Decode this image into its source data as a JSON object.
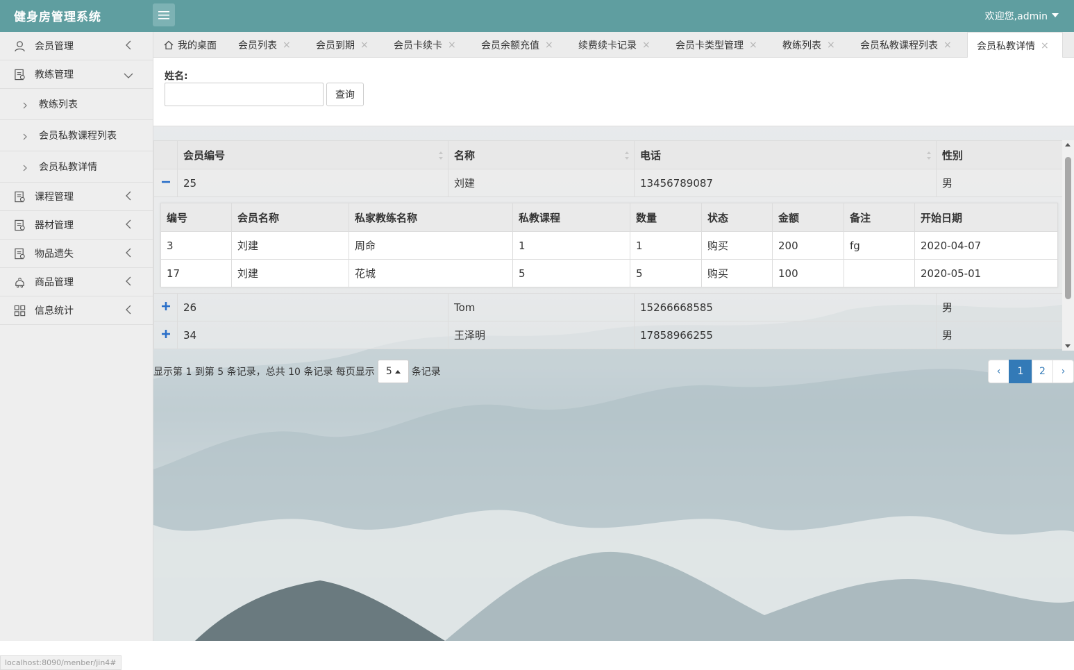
{
  "app": {
    "title": "健身房管理系统",
    "user_greeting": "欢迎您,admin"
  },
  "sidebar": {
    "items": [
      {
        "label": "会员管理",
        "icon": "user-icon"
      },
      {
        "label": "教练管理",
        "icon": "document-icon",
        "expanded": true,
        "children": [
          {
            "label": "教练列表"
          },
          {
            "label": "会员私教课程列表"
          },
          {
            "label": "会员私教详情"
          }
        ]
      },
      {
        "label": "课程管理",
        "icon": "document-icon"
      },
      {
        "label": "器材管理",
        "icon": "document-icon"
      },
      {
        "label": "物品遗失",
        "icon": "document-icon"
      },
      {
        "label": "商品管理",
        "icon": "cart-icon"
      },
      {
        "label": "信息统计",
        "icon": "grid-icon"
      }
    ]
  },
  "tabs": [
    {
      "label": "我的桌面",
      "closable": false
    },
    {
      "label": "会员列表",
      "closable": true
    },
    {
      "label": "会员到期",
      "closable": true
    },
    {
      "label": "会员卡续卡",
      "closable": true
    },
    {
      "label": "会员余额充值",
      "closable": true
    },
    {
      "label": "续费续卡记录",
      "closable": true
    },
    {
      "label": "会员卡类型管理",
      "closable": true
    },
    {
      "label": "教练列表",
      "closable": true
    },
    {
      "label": "会员私教课程列表",
      "closable": true
    },
    {
      "label": "会员私教详情",
      "closable": true,
      "active": true
    }
  ],
  "tab_close_glyph": "×",
  "search": {
    "label": "姓名:",
    "value": "",
    "placeholder": "",
    "button_label": "查询"
  },
  "table": {
    "columns": [
      "会员编号",
      "名称",
      "电话",
      "性别"
    ],
    "rows": [
      {
        "expander": "−",
        "cells": [
          "25",
          "刘建",
          "13456789087",
          "男"
        ]
      },
      {
        "expander": "+",
        "cells": [
          "26",
          "Tom",
          "15266668585",
          "男"
        ]
      },
      {
        "expander": "+",
        "cells": [
          "34",
          "王泽明",
          "17858966255",
          "男"
        ]
      }
    ],
    "detail": {
      "columns": [
        "编号",
        "会员名称",
        "私家教练名称",
        "私教课程",
        "数量",
        "状态",
        "金额",
        "备注",
        "开始日期"
      ],
      "rows": [
        [
          "3",
          "刘建",
          "周命",
          "1",
          "1",
          "购买",
          "200",
          "fg",
          "2020-04-07"
        ],
        [
          "17",
          "刘建",
          "花城",
          "5",
          "5",
          "购买",
          "100",
          "",
          "2020-05-01"
        ]
      ]
    }
  },
  "pagination": {
    "info_prefix": "显示第 1 到第 5 条记录，总共 10 条记录 每页显示",
    "page_size": "5",
    "info_suffix": "条记录",
    "prev": "‹",
    "pages": [
      "1",
      "2"
    ],
    "current_page": "1",
    "next": "›"
  },
  "status_bar": "localhost:8090/menber/jin4#",
  "colors": {
    "header": "#5f9ea0",
    "accent": "#337ab7",
    "expander": "#2a6fc9"
  }
}
